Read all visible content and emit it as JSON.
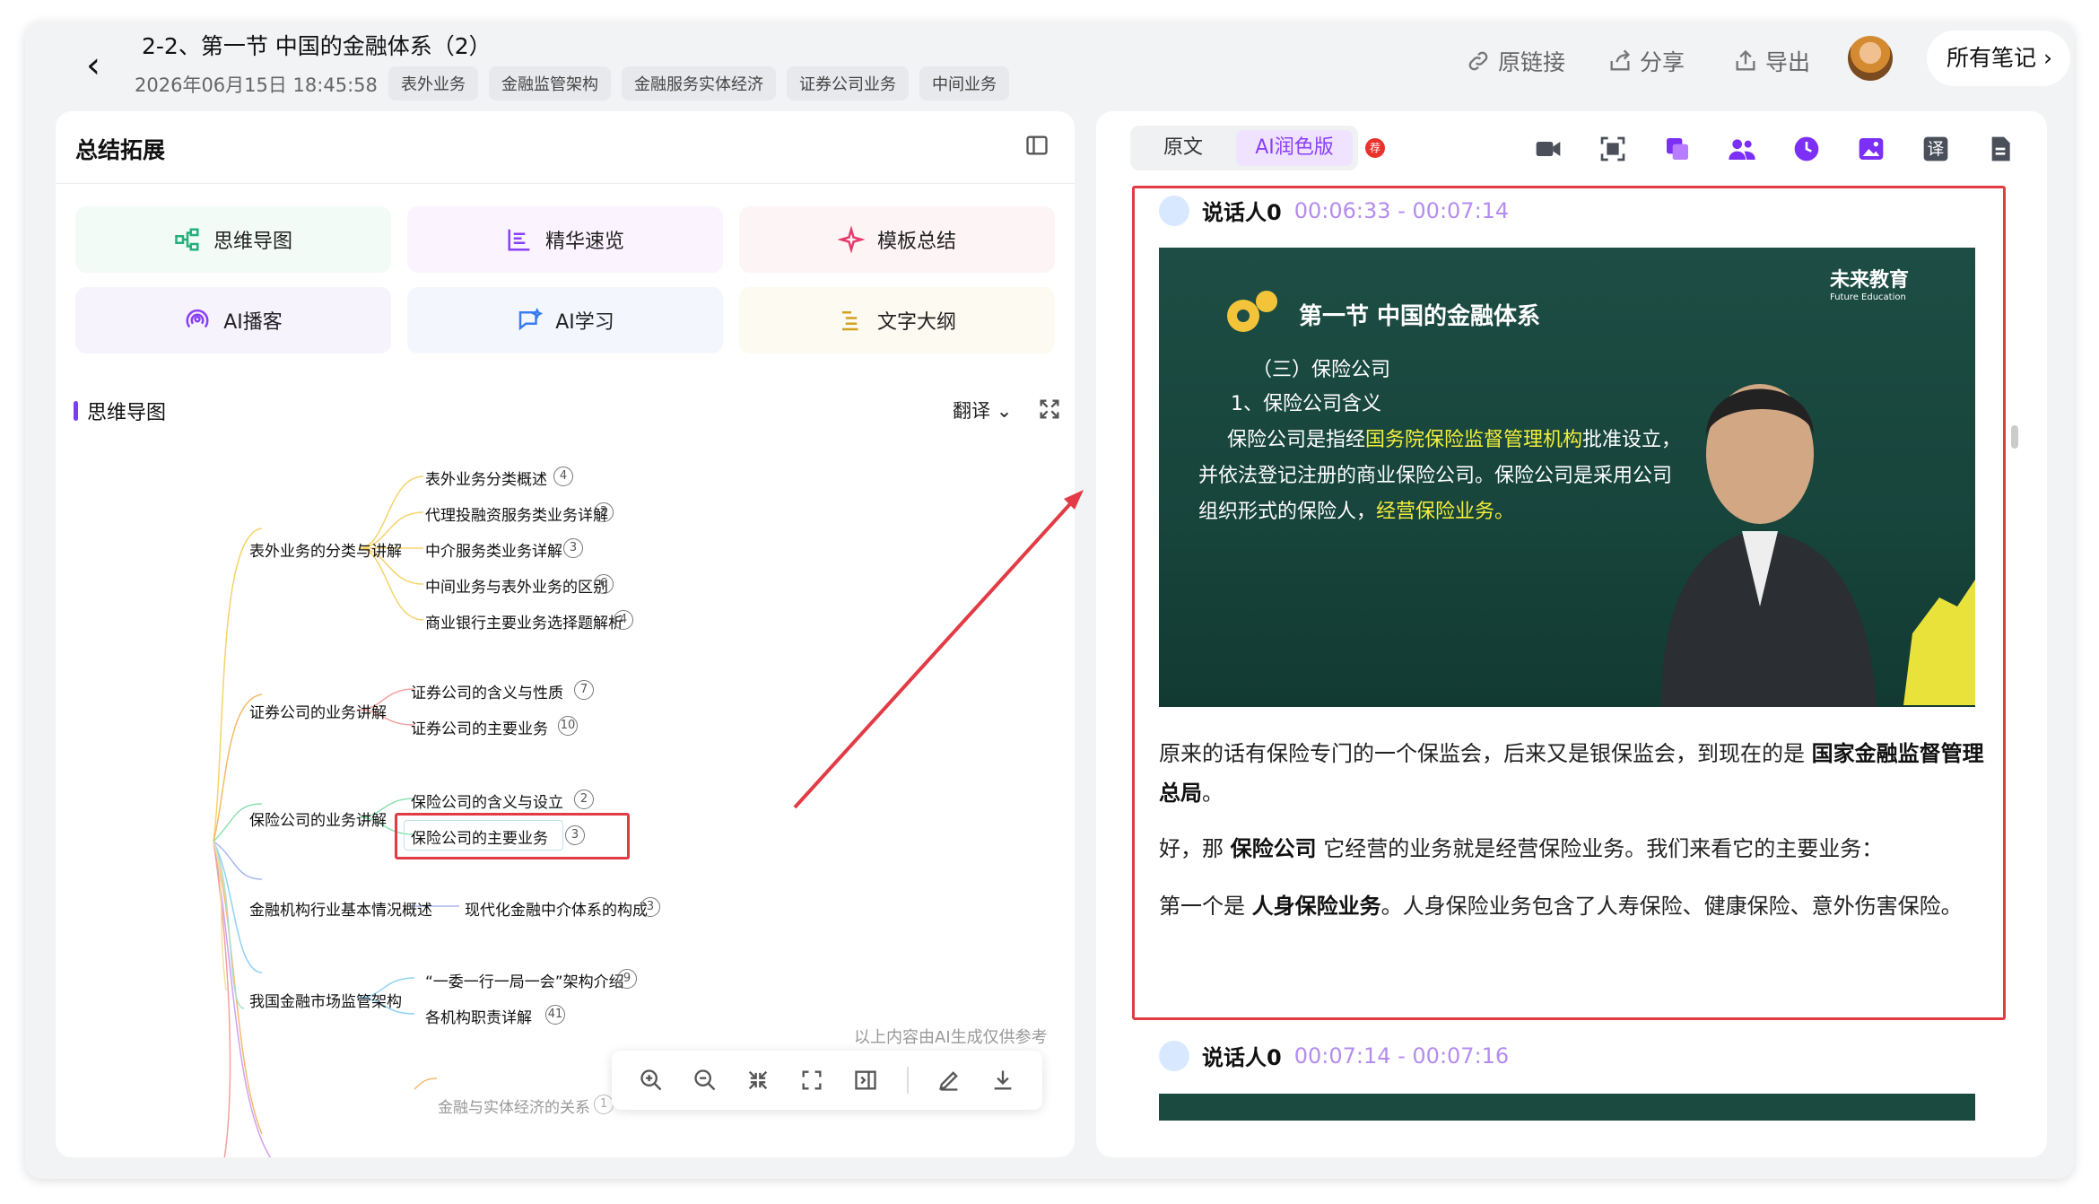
{
  "header": {
    "title": "2-2、第一节 中国的金融体系（2）",
    "datetime": "2026年06月15日 18:45:58",
    "tags": [
      "表外业务",
      "金融监管架构",
      "金融服务实体经济",
      "证券公司业务",
      "中间业务"
    ],
    "actions": {
      "link": "原链接",
      "share": "分享",
      "export": "导出"
    },
    "all_notes": "所有笔记"
  },
  "left": {
    "title": "总结拓展",
    "tools": [
      {
        "label": "思维导图",
        "icon": "mindmap-icon",
        "color": "#22b07d"
      },
      {
        "label": "精华速览",
        "icon": "highlights-icon",
        "color": "#8a3ffc"
      },
      {
        "label": "模板总结",
        "icon": "sparkle-icon",
        "color": "#e63a6c"
      },
      {
        "label": "AI播客",
        "icon": "podcast-icon",
        "color": "#8a3ffc"
      },
      {
        "label": "AI学习",
        "icon": "ai-learn-icon",
        "color": "#3a7bf2"
      },
      {
        "label": "文字大纲",
        "icon": "outline-icon",
        "color": "#d4a020"
      }
    ],
    "section": "思维导图",
    "translate": "翻译",
    "mindmap": {
      "branches": [
        {
          "label": "表外业务的分类与讲解",
          "children": [
            {
              "label": "表外业务分类概述",
              "count": "4"
            },
            {
              "label": "代理投融资服务类业务详解",
              "count": "3"
            },
            {
              "label": "中介服务类业务详解",
              "count": "3"
            },
            {
              "label": "中间业务与表外业务的区别",
              "count": "6"
            },
            {
              "label": "商业银行主要业务选择题解析",
              "count": "4"
            }
          ]
        },
        {
          "label": "证券公司的业务讲解",
          "children": [
            {
              "label": "证券公司的含义与性质",
              "count": "7"
            },
            {
              "label": "证券公司的主要业务",
              "count": "10"
            }
          ]
        },
        {
          "label": "保险公司的业务讲解",
          "children": [
            {
              "label": "保险公司的含义与设立",
              "count": "2"
            },
            {
              "label": "保险公司的主要业务",
              "count": "3"
            }
          ]
        },
        {
          "label": "金融机构行业基本情况概述",
          "children": [
            {
              "label": "现代化金融中介体系的构成",
              "count": "3"
            }
          ]
        },
        {
          "label": "我国金融市场监管架构",
          "children": [
            {
              "label": "“一委一行一局一会”架构介绍",
              "count": "9"
            },
            {
              "label": "各机构职责详解",
              "count": "41"
            }
          ]
        }
      ],
      "partial": {
        "label": "金融与实体经济的关系",
        "count": "1"
      }
    },
    "disclaimer": "以上内容由AI生成仅供参考"
  },
  "right": {
    "tabs": {
      "original": "原文",
      "ai": "AI润色版",
      "badge": "荐"
    },
    "speaker1": {
      "name": "说话人0",
      "time": "00:06:33 - 00:07:14"
    },
    "slide": {
      "title": "第一节  中国的金融体系",
      "l1": "（三）保险公司",
      "l2": "1、保险公司含义",
      "l3a": "保险公司是指经",
      "l3b": "国务院保险监督管理机构",
      "l3c": "批准设立，",
      "l4": "并依法登记注册的商业保险公司。保险公司是采用公司",
      "l5a": "组织形式的保险人，",
      "l5b": "经营保险业务。",
      "logo": "未来教育",
      "logo_sub": "Future Education"
    },
    "p1a": "原来的话有保险专门的一个保监会，后来又是银保监会，到现在的是 ",
    "p1b": "国家金融监督管理总局",
    "p2a": "好，那 ",
    "p2b": "保险公司",
    "p2c": " 它经营的业务就是经营保险业务。我们来看它的主要业务：",
    "p3a": "第一个是 ",
    "p3b": "人身保险业务",
    "p3c": "。人身保险业务包含了人寿保险、健康保险、意外伤害保险。",
    "speaker2": {
      "name": "说话人0",
      "time": "00:07:14 - 00:07:16"
    }
  }
}
